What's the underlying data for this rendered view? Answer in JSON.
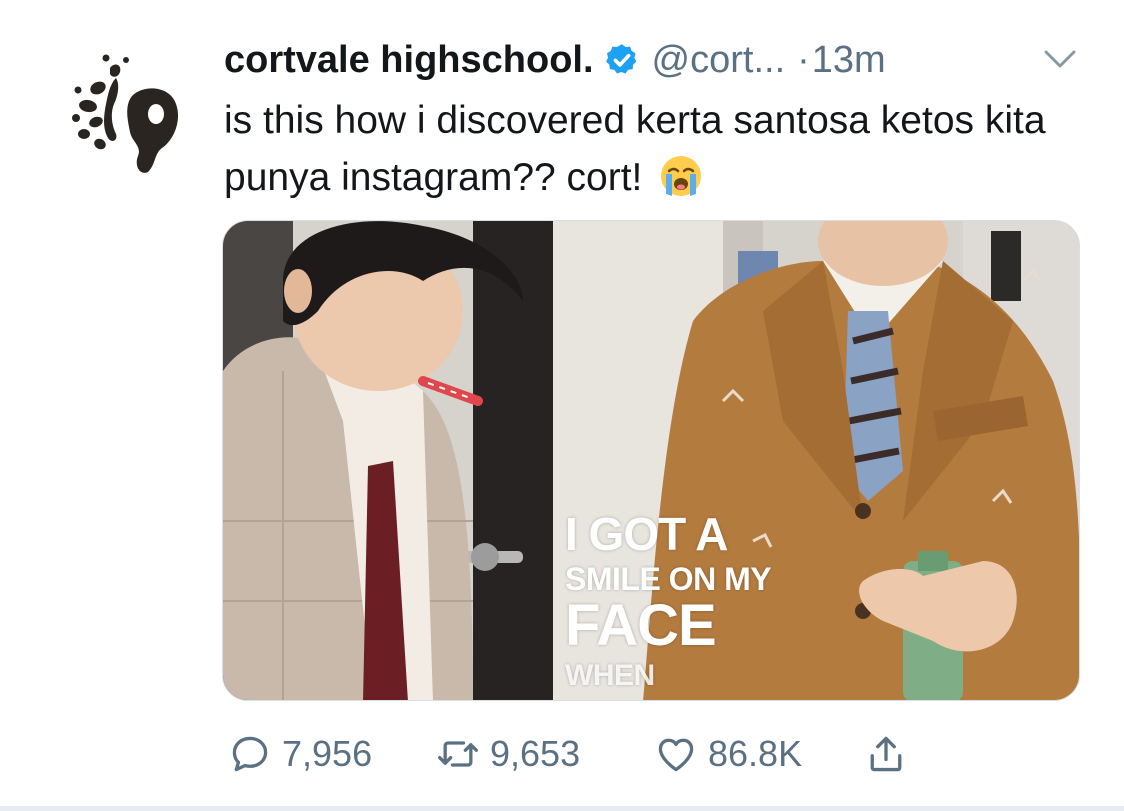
{
  "tweet": {
    "display_name": "cortvale highschool.",
    "handle": "@cort...",
    "separator": "·",
    "time": "13m",
    "text": "is this how i discovered kerta santosa ketos kita punya instagram?? cort!",
    "media": {
      "overlay_lines": [
        "I GOT A",
        "SMILE ON MY",
        "FACE",
        "WHEN"
      ]
    },
    "actions": {
      "reply_count": "7,956",
      "retweet_count": "9,653",
      "like_count": "86.8K"
    }
  },
  "icons": {
    "avatar": "ink-splatter-logo",
    "verified": "verified-badge-icon",
    "more": "chevron-down-icon",
    "emoji": "loudly-crying-face-emoji",
    "reply": "reply-icon",
    "retweet": "retweet-icon",
    "like": "heart-icon",
    "share": "share-icon"
  },
  "colors": {
    "text": "#14171a",
    "secondary": "#5b7083",
    "verified": "#1da1f2",
    "icon": "#5b7083"
  }
}
